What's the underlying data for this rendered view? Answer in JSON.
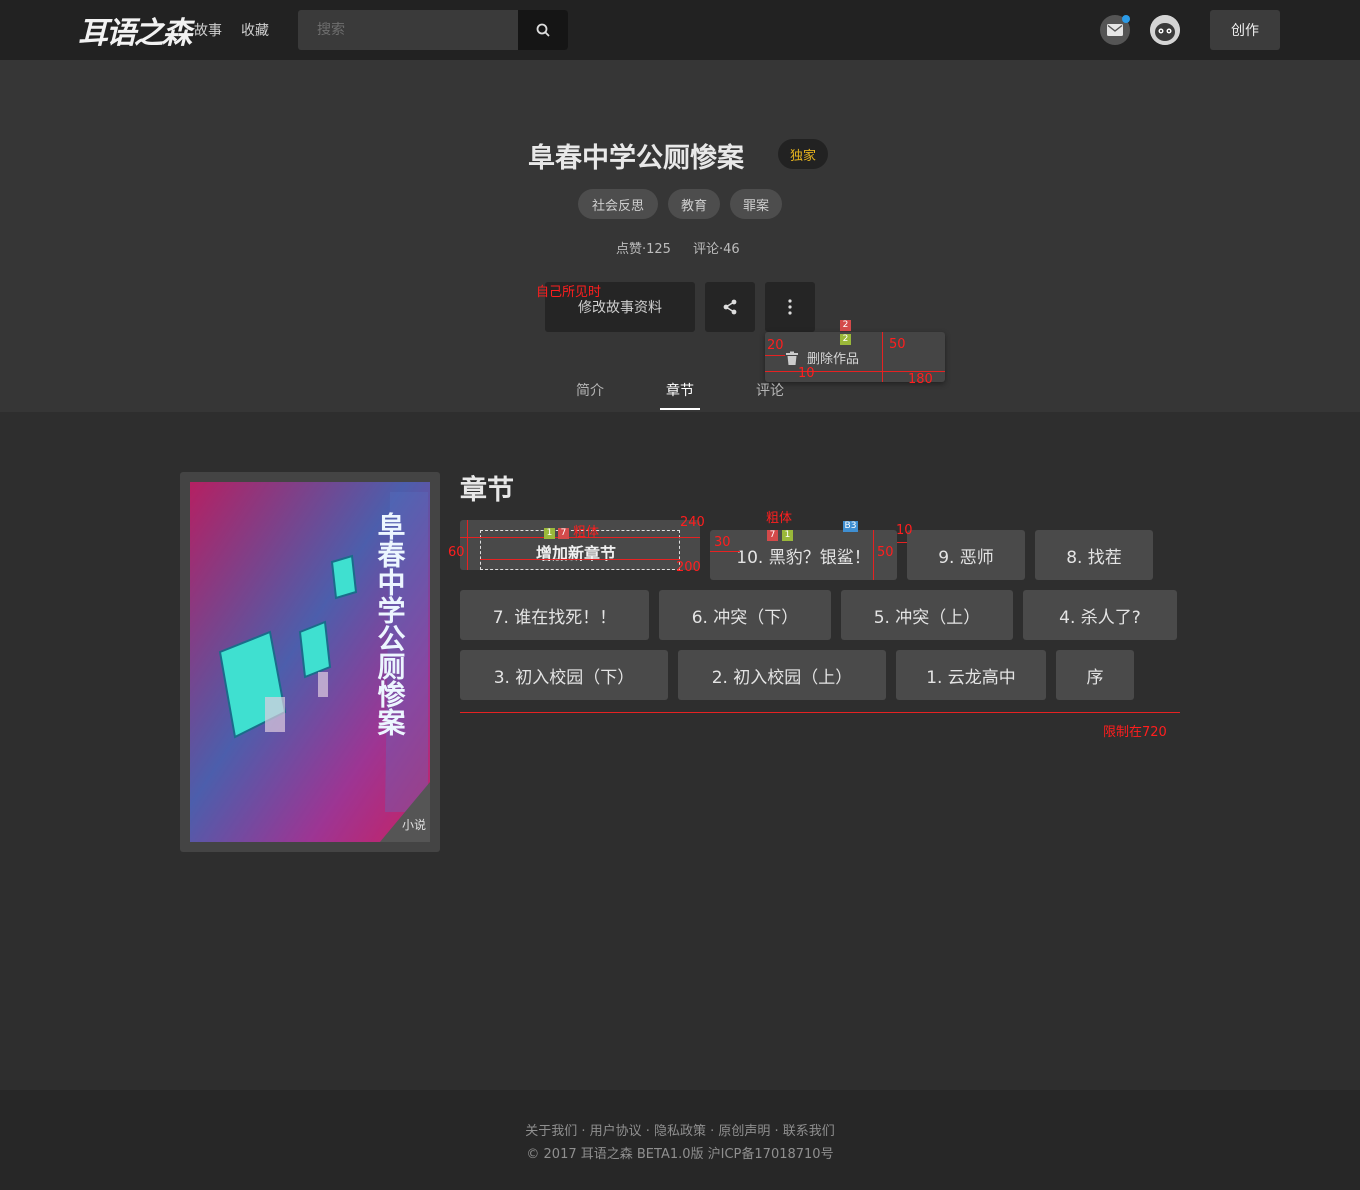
{
  "nav": {
    "logo": "耳语之森",
    "links": [
      "故事",
      "收藏"
    ],
    "search_placeholder": "搜索",
    "create_label": "创作"
  },
  "story": {
    "title": "阜春中学公厕惨案",
    "badge": "独家",
    "tags": [
      "社会反思",
      "教育",
      "罪案"
    ],
    "likes": "点赞·125",
    "comments": "评论·46",
    "edit_label": "修改故事资料",
    "menu_delete": "删除作品",
    "tabs": [
      "简介",
      "章节",
      "评论"
    ],
    "active_tab": "章节"
  },
  "cover": {
    "title_text": "阜春中学公厕惨案",
    "type_label": "小说"
  },
  "chapters": {
    "heading": "章节",
    "add_label": "增加新章节",
    "items": [
      "10. 黑豹？银鲨！",
      "9. 恶师",
      "8. 找茬",
      "7. 谁在找死！！",
      "6. 冲突（下）",
      "5. 冲突（上）",
      "4. 杀人了?",
      "3. 初入校园（下）",
      "2. 初入校园（上）",
      "1. 云龙高中",
      "序"
    ]
  },
  "annotations": {
    "self_visible": "自己所见时",
    "bold1": "粗体",
    "bold2": "粗体",
    "limit": "限制在720",
    "n20": "20",
    "n50a": "50",
    "n10a": "10",
    "n180": "180",
    "n240": "240",
    "n60": "60",
    "n200": "200",
    "n30": "30",
    "n50b": "50",
    "n10b": "10",
    "chip2a": "2",
    "chip2b": "2",
    "chip1a": "1",
    "chip7a": "7",
    "chip7b": "7",
    "chip1b": "1",
    "chipB3": "B3"
  },
  "footer": {
    "links": "关于我们 · 用户协议 · 隐私政策 · 原创声明 · 联系我们",
    "copyright": "© 2017 耳语之森 BETA1.0版 沪ICP备17018710号"
  },
  "colors": {
    "accent_badge": "#e6b31e",
    "annotation_red": "#ff1e1e",
    "notify_dot": "#2b9be8"
  }
}
